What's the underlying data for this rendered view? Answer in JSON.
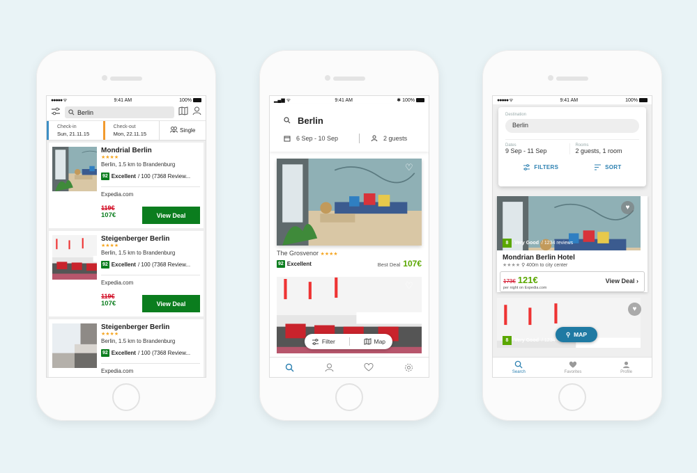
{
  "colors": {
    "accent": "#0b7d1e",
    "price_green": "#5aa700",
    "old_price": "#d0021b",
    "blue": "#2a7fb0",
    "map_button": "#1f7aa3"
  },
  "phone1": {
    "status": {
      "carrier": "●●●●● ᯤ",
      "time": "9:41 AM",
      "battery": "100%"
    },
    "search_value": "Berlin",
    "checkin": {
      "label": "Check-in",
      "value": "Sun, 21.11.15"
    },
    "checkout": {
      "label": "Check-out",
      "value": "Mon, 22.11.15"
    },
    "guests": "Single",
    "hotels": [
      {
        "name": "Mondrial Berlin",
        "stars": "★★★★",
        "dist": "Berlin, 1.5 km to Brandenburg",
        "score": "92",
        "rating": "Excellent",
        "reviews": "/ 100 (7368 Review...",
        "source": "Expedia.com",
        "old": "119€",
        "new": "107€",
        "cta": "View Deal"
      },
      {
        "name": "Steigenberger Berlin",
        "stars": "★★★★",
        "dist": "Berlin, 1.5 km to Brandenburg",
        "score": "92",
        "rating": "Excellent",
        "reviews": "/ 100 (7368 Review...",
        "source": "Expedia.com",
        "old": "119€",
        "new": "107€",
        "cta": "View Deal"
      },
      {
        "name": "Steigenberger Berlin",
        "stars": "★★★★",
        "dist": "Berlin, 1.5 km to Brandenburg",
        "score": "92",
        "rating": "Excellent",
        "reviews": "/ 100 (7368 Review...",
        "source": "Expedia.com",
        "old": "",
        "new": "",
        "cta": ""
      }
    ]
  },
  "phone2": {
    "status": {
      "carrier": "▂▄▆ ᯤ",
      "time": "9:41 AM",
      "battery": "✱ 100%"
    },
    "city": "Berlin",
    "dates": "6 Sep - 10 Sep",
    "guests": "2 guests",
    "hotel": {
      "name": "The Grosvenor",
      "stars": "★★★★",
      "score": "92",
      "rating": "Excellent",
      "best": "Best Deal",
      "price": "107€"
    },
    "filter_label": "Filter",
    "map_label": "Map"
  },
  "phone3": {
    "status": {
      "carrier": "●●●●● ᯤ",
      "time": "9:41 AM",
      "battery": "100%"
    },
    "destination_label": "Destination",
    "destination": "Berlin",
    "dates_label": "Dates",
    "dates": "9 Sep - 11 Sep",
    "rooms_label": "Rooms",
    "rooms": "2 guests, 1 room",
    "filters": "FILTERS",
    "sort": "SORT",
    "hotel": {
      "score": "8",
      "rating": "Very Good",
      "reviews": "/ 1234 reviews",
      "name": "Mondrian Berlin Hotel",
      "stars": "★★★★",
      "loc": "400m to city center",
      "old": "173€",
      "new": "121€",
      "per": "per night on Expedia.com",
      "cta": "View Deal"
    },
    "hotel2": {
      "score": "8",
      "rating": "Very Good",
      "reviews": "/ 1234 reviews"
    },
    "map": "MAP",
    "tabs": [
      "Search",
      "Favorites",
      "Profile"
    ]
  }
}
